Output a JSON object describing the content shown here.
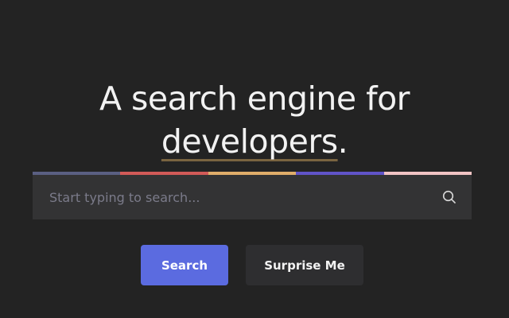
{
  "hero": {
    "title_line1": "A search engine for",
    "title_emphasis": "developers",
    "title_suffix": ".",
    "underline_color": "#7a6440"
  },
  "color_bar": [
    "#5a5f82",
    "#d25a58",
    "#e0ad6a",
    "#6054c8",
    "#f2c4c4"
  ],
  "search": {
    "placeholder": "Start typing to search...",
    "value": "",
    "icon": "search-icon"
  },
  "buttons": {
    "search_label": "Search",
    "surprise_label": "Surprise Me",
    "search_color": "#5b6be0"
  }
}
